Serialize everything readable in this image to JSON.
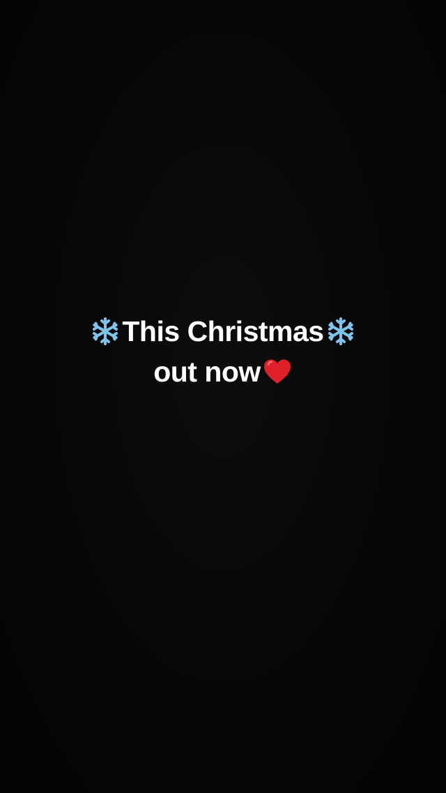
{
  "story": {
    "line1_text": "This Christmas",
    "line2_text": "out now",
    "line1_lead_icon": "snowflake-icon",
    "line1_trail_icon": "snowflake-icon",
    "line2_trail_icon": "red-heart-icon"
  },
  "colors": {
    "background": "#060606",
    "text": "#ffffff",
    "snowflake": "#7fc4ec",
    "heart": "#e0202a"
  }
}
